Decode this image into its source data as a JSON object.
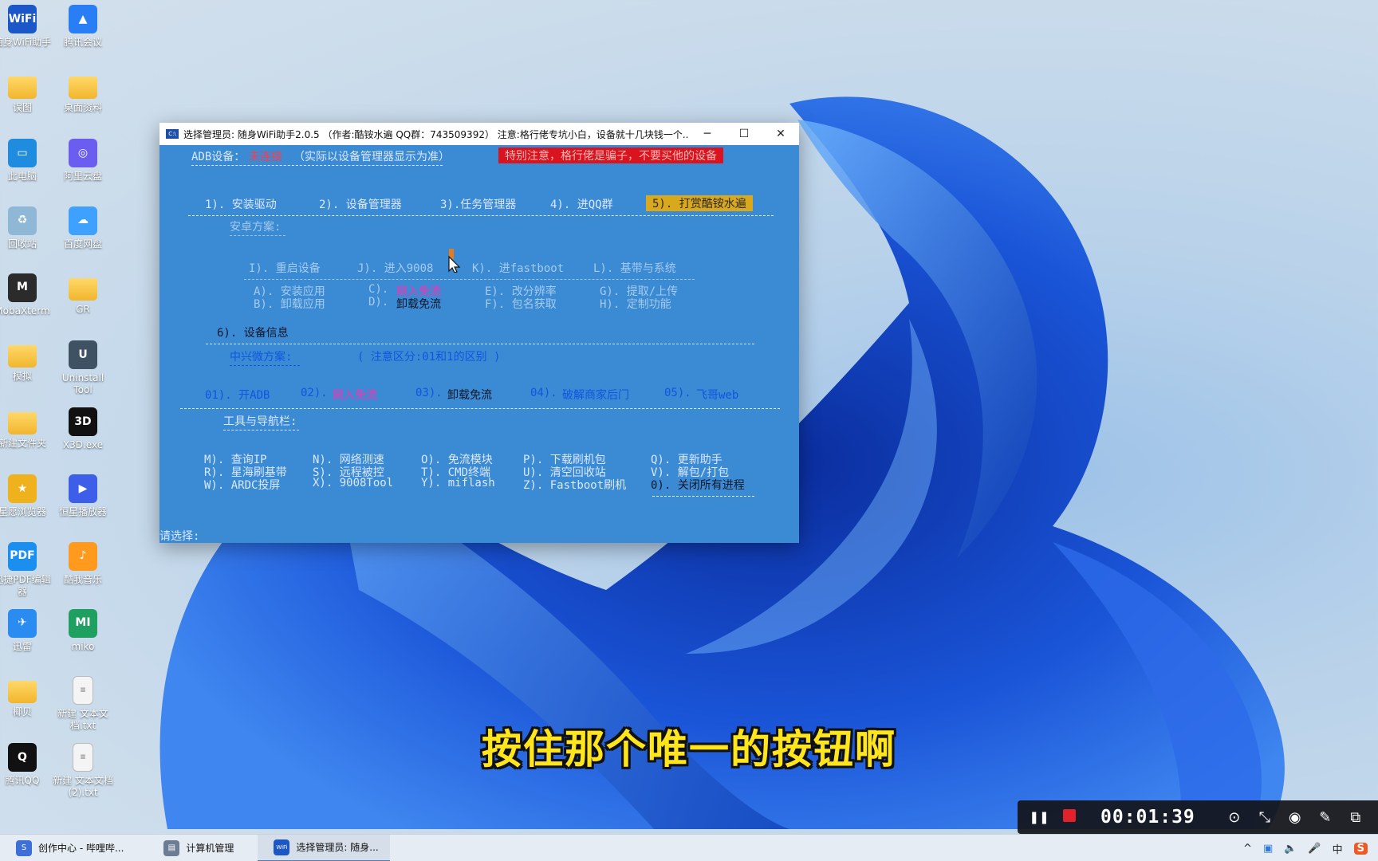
{
  "desktop": {
    "icons": [
      {
        "label": "随身WiFi助手",
        "icon": "wifi-app-icon",
        "glyph": "WiFi",
        "color": "#1b57c7"
      },
      {
        "label": "腾讯会议",
        "icon": "tencent-meeting-icon",
        "glyph": "▲",
        "color": "#2a7ef5"
      },
      {
        "label": "误图",
        "icon": "folder-icon",
        "glyph": "",
        "color": ""
      },
      {
        "label": "桌面资料",
        "icon": "folder-icon",
        "glyph": "",
        "color": ""
      },
      {
        "label": "此电脑",
        "icon": "computer-icon",
        "glyph": "▭",
        "color": "#1f8ce0"
      },
      {
        "label": "阿里云盘",
        "icon": "aliyun-drive-icon",
        "glyph": "◎",
        "color": "#6a5df0"
      },
      {
        "label": "回收站",
        "icon": "recycle-bin-icon",
        "glyph": "♻",
        "color": "#8fb7d6"
      },
      {
        "label": "百度网盘",
        "icon": "baidu-netdisk-icon",
        "glyph": "☁",
        "color": "#3ea0ff"
      },
      {
        "label": "MobaXterm",
        "icon": "mobaxterm-icon",
        "glyph": "M",
        "color": "#2b2b2b"
      },
      {
        "label": "GR",
        "icon": "folder-icon",
        "glyph": "",
        "color": ""
      },
      {
        "label": "模拟",
        "icon": "folder-icon",
        "glyph": "",
        "color": ""
      },
      {
        "label": "Uninstall Tool",
        "icon": "uninstall-tool-icon",
        "glyph": "U",
        "color": "#3f5263"
      },
      {
        "label": "新建文件夹",
        "icon": "folder-icon",
        "glyph": "",
        "color": ""
      },
      {
        "label": "X3D.exe",
        "icon": "x3d-icon",
        "glyph": "3D",
        "color": "#111"
      },
      {
        "label": "星愿浏览器",
        "icon": "star-browser-icon",
        "glyph": "★",
        "color": "#f0b21c"
      },
      {
        "label": "恒星播放器",
        "icon": "player-icon",
        "glyph": "▶",
        "color": "#3c5ee8"
      },
      {
        "label": "迅捷PDF编辑器",
        "icon": "pdf-editor-icon",
        "glyph": "PDF",
        "color": "#1a8ff0"
      },
      {
        "label": "酷我音乐",
        "icon": "kuwo-music-icon",
        "glyph": "♪",
        "color": "#ff9a1f"
      },
      {
        "label": "迅雷",
        "icon": "xunlei-icon",
        "glyph": "✈",
        "color": "#2a8cf0"
      },
      {
        "label": "miko",
        "icon": "miko-icon",
        "glyph": "MI",
        "color": "#20a060"
      },
      {
        "label": "椰贝",
        "icon": "folder-icon",
        "glyph": "",
        "color": ""
      },
      {
        "label": "新建 文本文档.txt",
        "icon": "text-file-icon",
        "glyph": "≡",
        "color": ""
      },
      {
        "label": "腾讯QQ",
        "icon": "qq-icon",
        "glyph": "Q",
        "color": "#111"
      },
      {
        "label": "新建 文本文档 (2).txt",
        "icon": "text-file-icon",
        "glyph": "≡",
        "color": ""
      }
    ]
  },
  "window": {
    "title": "选择管理员:  随身WiFi助手2.0.5 （作者:酷铵水遍 QQ群：743509392） 注意:格行佬专坑小白，设备就十几块钱一个...",
    "app_icon_text": "C:\\",
    "min_symbol": "─",
    "max_symbol": "☐",
    "close_symbol": "✕"
  },
  "console": {
    "adb_label": "ADB设备：",
    "adb_status": "未连接",
    "adb_note": "（实际以设备管理器显示为准）",
    "warning": "特别注意，格行佬是骗子，不要买他的设备",
    "top_menu": [
      "1). 安装驱动",
      "2). 设备管理器",
      "3).任务管理器",
      "4). 进QQ群"
    ],
    "donate": "5). 打赏酷铵水遍",
    "android_header": "安卓方案:",
    "android_row1": [
      "I). 重启设备",
      "J). 进入9008",
      "K). 进fastboot",
      "L). 基带与系统"
    ],
    "android_row2": [
      "A). 安装应用",
      "C).",
      "刷入免流",
      "E). 改分辨率",
      "G). 提取/上传"
    ],
    "android_row3": [
      "B). 卸载应用",
      "D).",
      "卸载免流",
      "F). 包名获取",
      "H). 定制功能"
    ],
    "device_info": "6). 设备信息",
    "zte_header": "中兴微方案:",
    "zte_note": "( 注意区分:01和1的区别 )",
    "zte_row": [
      "01). 开ADB",
      "02).",
      "刷入免流",
      "03).",
      "卸载免流",
      "04).",
      "破解商家后门",
      "05).",
      "飞哥web"
    ],
    "tools_header": "工具与导航栏:",
    "tools_row1": [
      "M). 查询IP",
      "N). 网络测速",
      "O). 免流模块",
      "P). 下载刷机包",
      "Q). 更新助手"
    ],
    "tools_row2": [
      "R). 星海刷基带",
      "S). 远程被控",
      "T). CMD终端",
      "U). 清空回收站",
      "V). 解包/打包"
    ],
    "tools_row3": [
      "W). ARDC投屏",
      "X). 9008Tool",
      "Y). miflash",
      "Z). Fastboot刷机",
      "0). 关闭所有进程"
    ],
    "prompt": "请选择:"
  },
  "subtitle": "按住那个唯一的按钮啊",
  "recorder": {
    "timer": "00:01:39",
    "pause_icon": "❚❚",
    "buttons": [
      "⊙",
      "⤡",
      "◉",
      "✎",
      "⧉"
    ]
  },
  "taskbar": {
    "items": [
      {
        "label": "创作中心 - 哔哩哔...",
        "icon": "bilibili-icon",
        "color": "#3d6fd8"
      },
      {
        "label": "计算机管理",
        "icon": "computer-management-icon",
        "color": "#6b7d95"
      },
      {
        "label": "选择管理员:  随身...",
        "icon": "wifi-app-icon",
        "color": "#1b57c7"
      }
    ],
    "tray": [
      "^",
      "▣",
      "🔈",
      "🎤",
      "中",
      "S"
    ]
  },
  "colors": {
    "console_bg": "#3b8ad4",
    "subtitle": "#ffe61c",
    "warning_bg": "#d9141e",
    "donate_bg": "#d9a81c"
  }
}
